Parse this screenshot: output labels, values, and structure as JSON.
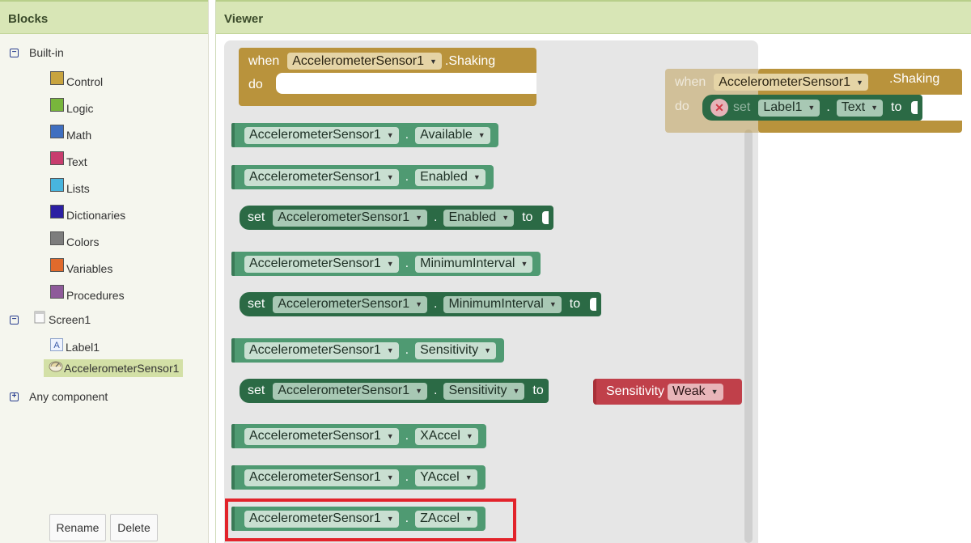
{
  "blocks_panel": {
    "title": "Blocks",
    "builtin": {
      "label": "Built-in",
      "items": [
        {
          "label": "Control",
          "color": "#c8a43f"
        },
        {
          "label": "Logic",
          "color": "#78b63c"
        },
        {
          "label": "Math",
          "color": "#3f6fc0"
        },
        {
          "label": "Text",
          "color": "#c83d6e"
        },
        {
          "label": "Lists",
          "color": "#48b5de"
        },
        {
          "label": "Dictionaries",
          "color": "#2b1fa3"
        },
        {
          "label": "Colors",
          "color": "#7d7d7d"
        },
        {
          "label": "Variables",
          "color": "#e06a2c"
        },
        {
          "label": "Procedures",
          "color": "#8e5a9a"
        }
      ]
    },
    "screen": {
      "label": "Screen1",
      "components": [
        "Label1",
        "AccelerometerSensor1"
      ]
    },
    "any_component": "Any component",
    "rename_label": "Rename",
    "delete_label": "Delete"
  },
  "viewer": {
    "title": "Viewer",
    "flyout": {
      "event": {
        "when": "when",
        "component": "AccelerometerSensor1",
        "event_name": ".Shaking",
        "do": "do"
      },
      "component": "AccelerometerSensor1",
      "set_kw": "set",
      "to_kw": "to",
      "props": {
        "available": "Available",
        "enabled": "Enabled",
        "min_interval": "MinimumInterval",
        "sensitivity": "Sensitivity",
        "xaccel": "XAccel",
        "yaccel": "YAccel",
        "zaccel": "ZAccel"
      },
      "sensitivity_enum": {
        "label": "Sensitivity",
        "value": "Weak"
      }
    },
    "workspace": {
      "when": "when",
      "component": "AccelerometerSensor1",
      "event_name": ".Shaking",
      "do": "do",
      "set_kw": "set",
      "target": "Label1",
      "prop": "Text",
      "to_kw": "to"
    }
  }
}
